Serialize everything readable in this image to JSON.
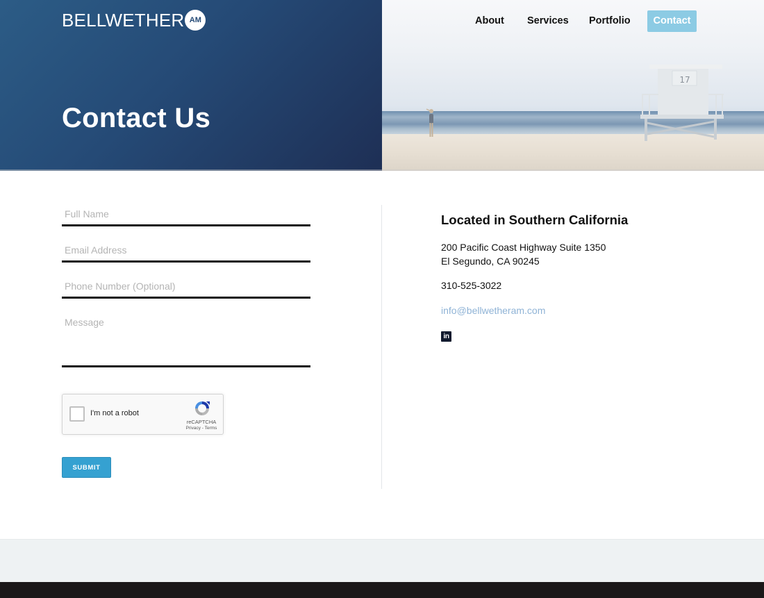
{
  "brand": {
    "name": "BELLWETHER",
    "badge": "AM"
  },
  "nav": {
    "items": [
      {
        "label": "About",
        "active": false
      },
      {
        "label": "Services",
        "active": false
      },
      {
        "label": "Portfolio",
        "active": false
      },
      {
        "label": "Contact",
        "active": true
      }
    ]
  },
  "hero": {
    "title": "Contact Us",
    "image_alt": "Beach with lifeguard tower 17",
    "tower_number": "17"
  },
  "form": {
    "full_name": {
      "placeholder": "Full Name",
      "value": ""
    },
    "email": {
      "placeholder": "Email Address",
      "value": ""
    },
    "phone": {
      "placeholder": "Phone Number (Optional)",
      "value": ""
    },
    "message": {
      "placeholder": "Message",
      "value": ""
    },
    "recaptcha": {
      "label": "I'm not a robot",
      "brand": "reCAPTCHA",
      "links": "Privacy - Terms",
      "checked": false
    },
    "submit_label": "SUBMIT"
  },
  "contact": {
    "title": "Located in Southern California",
    "address_line1": "200 Pacific Coast Highway Suite 1350",
    "address_line2": "El Segundo, CA 90245",
    "phone": "310-525-3022",
    "email": "info@bellwetheram.com",
    "social": [
      {
        "icon": "linkedin-icon",
        "label": "in"
      }
    ]
  },
  "colors": {
    "hero_blue": "#254a76",
    "nav_active": "#8ccbe4",
    "submit": "#35a1d1",
    "email_link": "#8fb3d6",
    "footer_light": "#eef2f3",
    "footer_dark": "#1b1819"
  }
}
